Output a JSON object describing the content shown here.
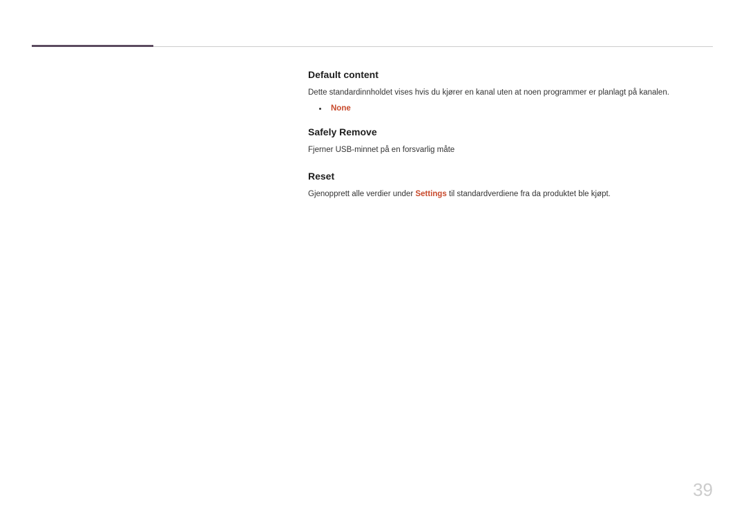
{
  "sections": {
    "default_content": {
      "heading": "Default content",
      "body": "Dette standardinnholdet vises hvis du kjører en kanal uten at noen programmer er planlagt på kanalen.",
      "bullet_value": "None"
    },
    "safely_remove": {
      "heading": "Safely Remove",
      "body": "Fjerner USB-minnet på en forsvarlig måte"
    },
    "reset": {
      "heading": "Reset",
      "body_pre": "Gjenopprett alle verdier under ",
      "body_highlight": "Settings",
      "body_post": " til standardverdiene fra da produktet ble kjøpt."
    }
  },
  "page_number": "39"
}
